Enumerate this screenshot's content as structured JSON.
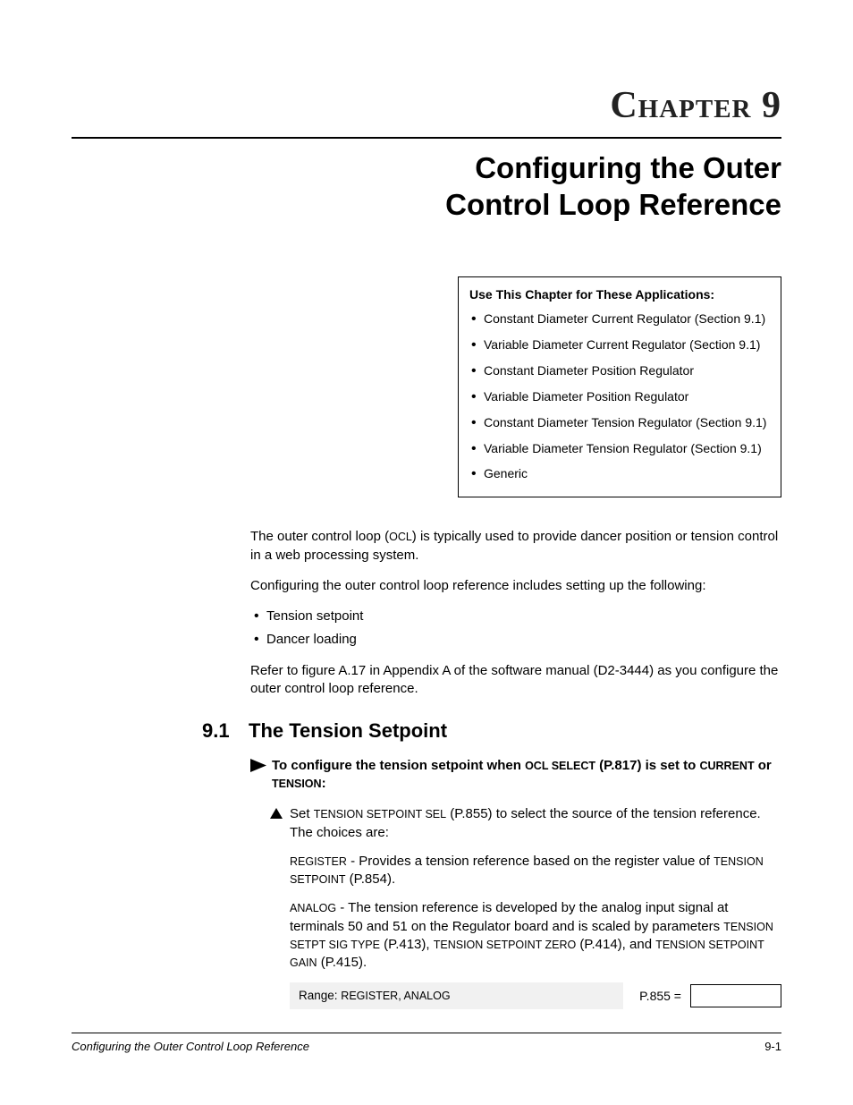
{
  "chapter": {
    "label_word": "Chapter",
    "label_num": "9",
    "title_line1": "Configuring the Outer",
    "title_line2": "Control Loop Reference"
  },
  "apps_box": {
    "title": "Use This Chapter for These Applications:",
    "items": [
      "Constant Diameter Current Regulator (Section 9.1)",
      "Variable Diameter Current Regulator (Section 9.1)",
      "Constant Diameter Position Regulator",
      "Variable Diameter Position Regulator",
      "Constant Diameter Tension Regulator (Section 9.1)",
      "Variable Diameter Tension Regulator (Section 9.1)",
      "Generic"
    ]
  },
  "intro": {
    "p1a": "The outer control loop (",
    "p1b": "OCL",
    "p1c": ") is typically used to provide dancer position or tension control in a web processing system.",
    "p2": "Configuring the outer control loop reference includes setting up the following:",
    "setup_items": [
      "Tension setpoint",
      "Dancer loading"
    ],
    "p3": "Refer to figure A.17 in Appendix A of the software manual (D2-3444) as you configure the outer control loop reference."
  },
  "section": {
    "num": "9.1",
    "title": "The Tension Setpoint",
    "lead_a": "To configure the tension setpoint when ",
    "lead_b": "OCL SELECT",
    "lead_c": " (P.817) is set to ",
    "lead_d": "CURRENT",
    "lead_e": " or ",
    "lead_f": "TENSION",
    "lead_g": ":",
    "step1_a": "Set ",
    "step1_b": "TENSION SETPOINT SEL",
    "step1_c": " (P.855) to select the source of the tension reference. The choices are:",
    "choice1_a": "REGISTER",
    "choice1_b": " - Provides a tension reference based on the register value of ",
    "choice1_c": "TENSION SETPOINT",
    "choice1_d": " (P.854).",
    "choice2_a": "ANALOG",
    "choice2_b": " - The tension reference is developed by the analog input signal at terminals 50 and 51 on the Regulator board and is scaled by parameters ",
    "choice2_c": "TENSION SETPT SIG TYPE",
    "choice2_d": " (P.413), ",
    "choice2_e": "TENSION SETPOINT ZERO",
    "choice2_f": " (P.414), and ",
    "choice2_g": "TENSION SETPOINT GAIN",
    "choice2_h": " (P.415).",
    "range_label": "Range: ",
    "range_val": "REGISTER, ANALOG",
    "param_eq": "P.855 ="
  },
  "footer": {
    "left": "Configuring the Outer Control Loop Reference",
    "right": "9-1"
  }
}
